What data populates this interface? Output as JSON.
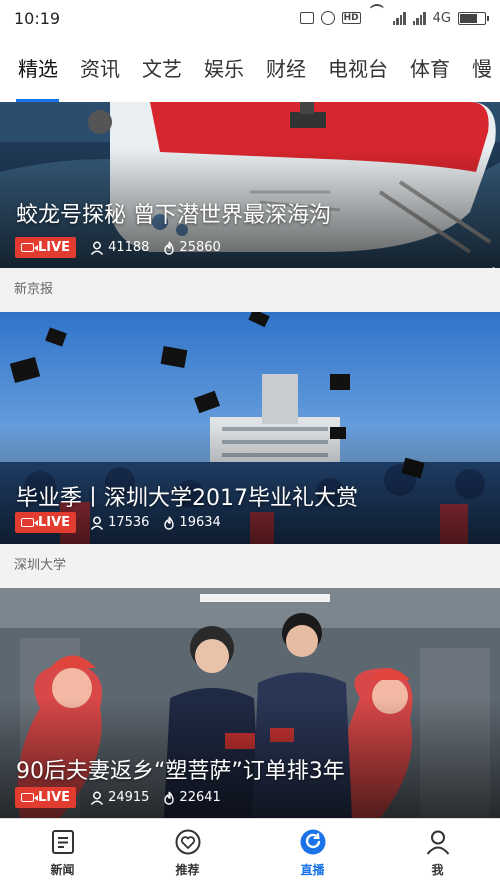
{
  "status_bar": {
    "time": "10:19",
    "network": "4G",
    "icons": [
      "vibrate-icon",
      "alarm-icon",
      "hd-icon",
      "wifi-icon",
      "signal-icon",
      "signal-icon",
      "battery-icon"
    ]
  },
  "tabs": [
    {
      "label": "精选",
      "active": true
    },
    {
      "label": "资讯",
      "active": false
    },
    {
      "label": "文艺",
      "active": false
    },
    {
      "label": "娱乐",
      "active": false
    },
    {
      "label": "财经",
      "active": false
    },
    {
      "label": "电视台",
      "active": false
    },
    {
      "label": "体育",
      "active": false
    },
    {
      "label": "慢",
      "active": false
    }
  ],
  "feed": {
    "cards": [
      {
        "title": "蛟龙号探秘 曾下潜世界最深海沟",
        "live": "LIVE",
        "viewers": "41188",
        "likes": "25860",
        "source": "新京报"
      },
      {
        "title": "毕业季丨深圳大学2017毕业礼大赏",
        "live": "LIVE",
        "viewers": "17536",
        "likes": "19634",
        "source": "深圳大学"
      },
      {
        "title": "90后夫妻返乡“塑菩萨”订单排3年",
        "live": "LIVE",
        "viewers": "24915",
        "likes": "22641"
      }
    ]
  },
  "bottom_nav": [
    {
      "label": "新闻",
      "icon": "news-icon",
      "active": false
    },
    {
      "label": "推荐",
      "icon": "heart-icon",
      "active": false
    },
    {
      "label": "直播",
      "icon": "live-icon",
      "active": true
    },
    {
      "label": "我",
      "icon": "profile-icon",
      "active": false
    }
  ],
  "colors": {
    "accent": "#1a73e8",
    "live_badge": "#e23b2f"
  }
}
